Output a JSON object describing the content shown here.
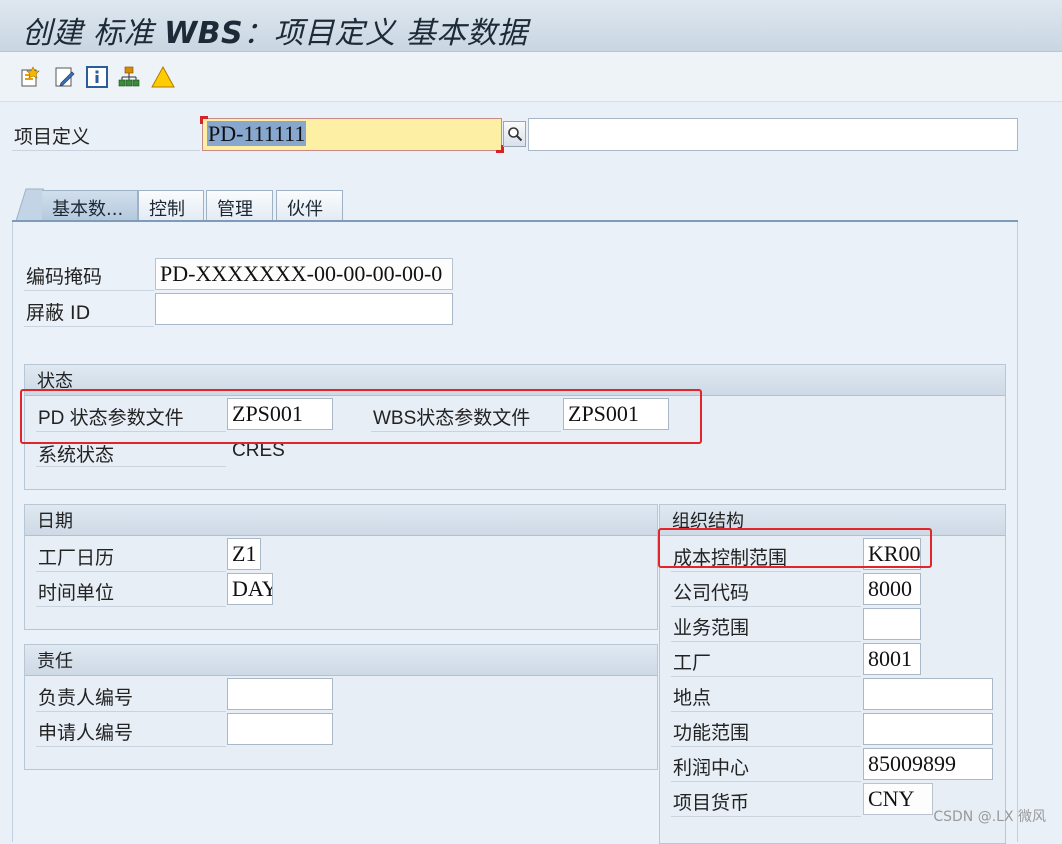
{
  "title": {
    "part1": "创建 标准 ",
    "part2": "WBS",
    "part3": "：项目定义 基本数据"
  },
  "toolbar": {
    "icons": [
      "create-icon",
      "edit-icon",
      "info-icon",
      "hierarchy-icon",
      "warning-icon"
    ]
  },
  "header": {
    "project_def_label": "项目定义",
    "project_def_value": "PD-111111",
    "project_desc_value": ""
  },
  "tabs": [
    "基本数...",
    "控制",
    "管理",
    "伙伴"
  ],
  "basic": {
    "mask_label": "编码掩码",
    "mask_value": "PD-XXXXXXX-00-00-00-00-0",
    "mask_id_label": "屏蔽 ID",
    "mask_id_value": ""
  },
  "status": {
    "title": "状态",
    "pd_profile_label": "PD 状态参数文件",
    "pd_profile_value": "ZPS001",
    "wbs_profile_label": "WBS状态参数文件",
    "wbs_profile_value": "ZPS001",
    "system_status_label": "系统状态",
    "system_status_value": "CRES"
  },
  "dates": {
    "title": "日期",
    "calendar_label": "工厂日历",
    "calendar_value": "Z1",
    "unit_label": "时间单位",
    "unit_value": "DAY"
  },
  "responsibility": {
    "title": "责任",
    "person_label": "负责人编号",
    "person_value": "",
    "applicant_label": "申请人编号",
    "applicant_value": ""
  },
  "org": {
    "title": "组织结构",
    "rows": [
      {
        "label": "成本控制范围",
        "value": "KR00"
      },
      {
        "label": "公司代码",
        "value": "8000"
      },
      {
        "label": "业务范围",
        "value": ""
      },
      {
        "label": "工厂",
        "value": "8001"
      },
      {
        "label": "地点",
        "value": ""
      },
      {
        "label": "功能范围",
        "value": ""
      },
      {
        "label": "利润中心",
        "value": "85009899"
      },
      {
        "label": "项目货币",
        "value": "CNY"
      }
    ]
  },
  "watermark": "CSDN @.LX 微风",
  "colors": {
    "highlight_red": "#e0252b",
    "required_yellow": "#fdf0a4"
  }
}
